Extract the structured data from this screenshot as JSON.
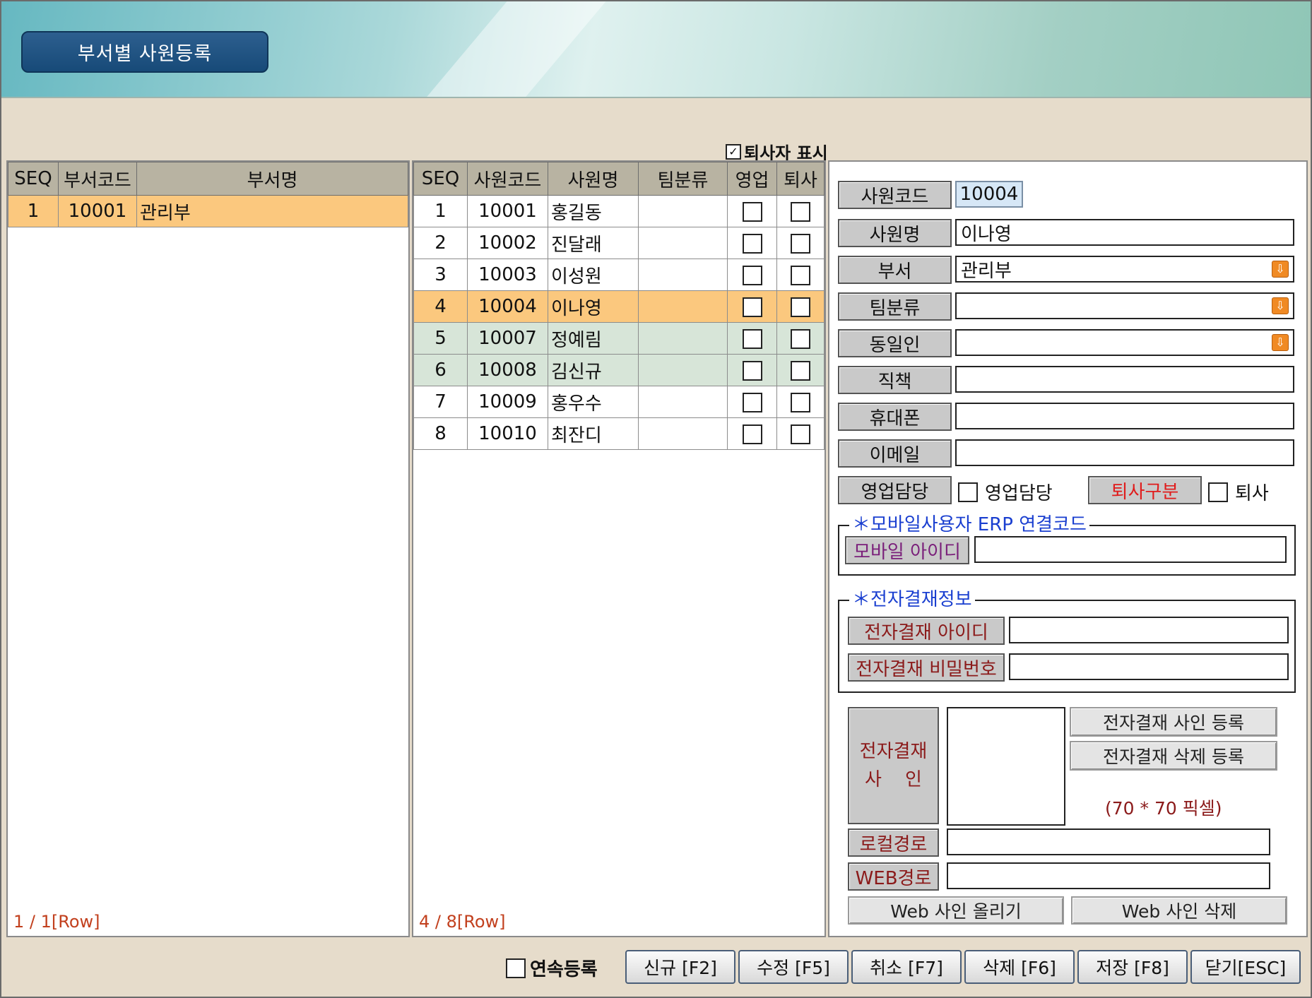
{
  "title": "부서별 사원등록",
  "show_retired_label": "퇴사자 표시",
  "dept_grid": {
    "headers": [
      "SEQ",
      "부서코드",
      "부서명"
    ],
    "rows": [
      [
        "1",
        "10001",
        "관리부"
      ]
    ],
    "row_info": "1 / 1[Row]"
  },
  "emp_grid": {
    "headers": [
      "SEQ",
      "사원코드",
      "사원명",
      "팀분류",
      "영업",
      "퇴사"
    ],
    "rows": [
      [
        "1",
        "10001",
        "홍길동",
        ""
      ],
      [
        "2",
        "10002",
        "진달래",
        ""
      ],
      [
        "3",
        "10003",
        "이성원",
        ""
      ],
      [
        "4",
        "10004",
        "이나영",
        ""
      ],
      [
        "5",
        "10007",
        "정예림",
        ""
      ],
      [
        "6",
        "10008",
        "김신규",
        ""
      ],
      [
        "7",
        "10009",
        "홍우수",
        ""
      ],
      [
        "8",
        "10010",
        "최잔디",
        ""
      ]
    ],
    "row_info": "4 / 8[Row]"
  },
  "detail": {
    "emp_code_label": "사원코드",
    "emp_code": "10004",
    "emp_name_label": "사원명",
    "emp_name": "이나영",
    "dept_label": "부서",
    "dept": "관리부",
    "team_label": "팀분류",
    "team": "",
    "same_label": "동일인",
    "same": "",
    "position_label": "직책",
    "position": "",
    "mobile_label": "휴대폰",
    "mobile": "",
    "email_label": "이메일",
    "email": "",
    "sales_label": "영업담당",
    "sales_check_label": "영업담당",
    "retire_label": "퇴사구분",
    "retire_check_label": "퇴사"
  },
  "mobile_section": {
    "legend": "＊모바일사용자 ERP 연결코드",
    "id_label": "모바일 아이디",
    "id": ""
  },
  "approval_section": {
    "legend": "＊전자결재정보",
    "id_label": "전자결재 아이디",
    "id": "",
    "pw_label": "전자결재 비밀번호",
    "pw": ""
  },
  "signature": {
    "label_line1": "전자결재",
    "label_line2": "사    인",
    "register_btn": "전자결재 사인 등록",
    "delete_btn": "전자결재 삭제 등록",
    "size_note": "(70 * 70 픽셀)",
    "local_label": "로컬경로",
    "local_path": "",
    "web_label": "WEB경로",
    "web_path": "",
    "web_upload_btn": "Web 사인 올리기",
    "web_delete_btn": "Web 사인 삭제"
  },
  "bottom": {
    "continuous_label": "연속등록",
    "buttons": [
      "신규 [F2]",
      "수정 [F5]",
      "취소 [F7]",
      "삭제 [F6]",
      "저장 [F8]",
      "닫기[ESC]"
    ]
  },
  "colors": {
    "selected_row": "#fbc87e",
    "alt_row": "#d7e5d8",
    "header_bg": "#b8b3a2",
    "legend_blue": "#1a3fd0"
  }
}
